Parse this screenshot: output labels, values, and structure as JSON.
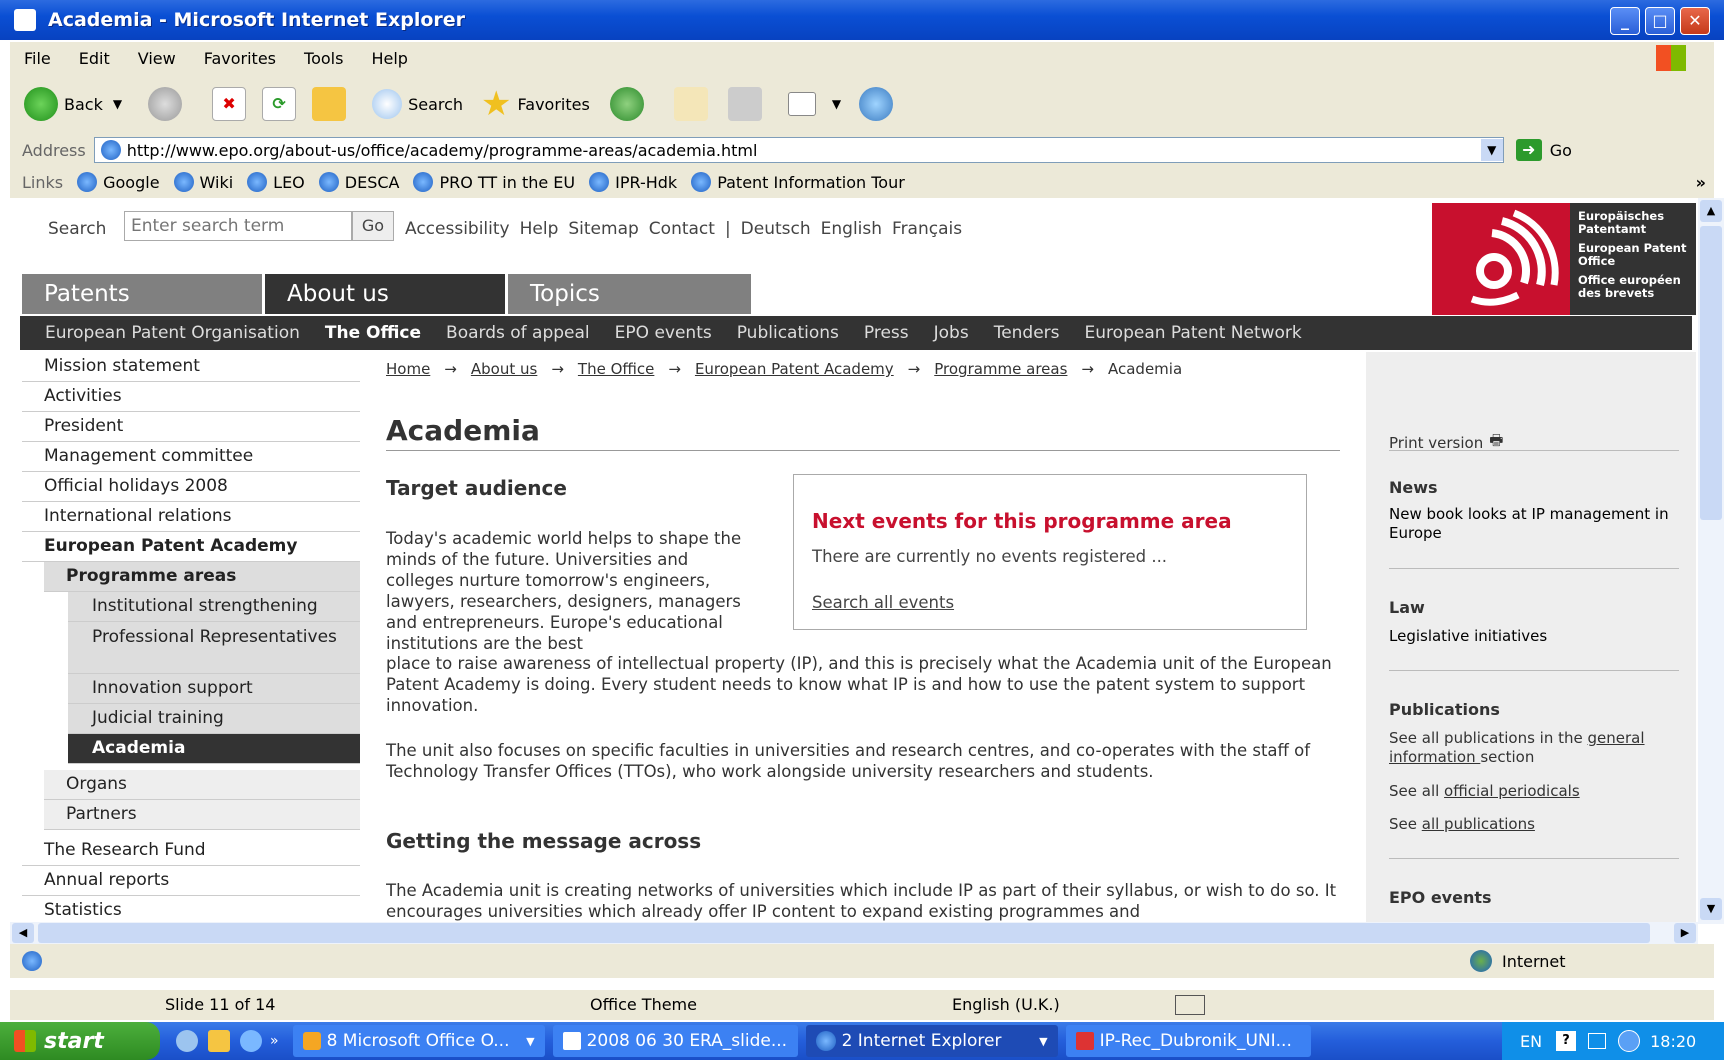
{
  "window": {
    "title": "Academia - Microsoft Internet Explorer"
  },
  "menu": [
    "File",
    "Edit",
    "View",
    "Favorites",
    "Tools",
    "Help"
  ],
  "toolbar": {
    "back": "Back",
    "search": "Search",
    "favorites": "Favorites"
  },
  "address": {
    "label": "Address",
    "url": "http://www.epo.org/about-us/office/academy/programme-areas/academia.html",
    "go": "Go"
  },
  "links": {
    "label": "Links",
    "items": [
      "Google",
      "Wiki",
      "LEO",
      "DESCA",
      "PRO TT in the EU",
      "IPR-Hdk",
      "Patent Information Tour"
    ]
  },
  "site": {
    "search_label": "Search",
    "search_placeholder": "Enter search term",
    "search_go": "Go",
    "utility": [
      "Accessibility",
      "Help",
      "Sitemap",
      "Contact",
      "|",
      "Deutsch",
      "English",
      "Français"
    ],
    "logo": [
      "Europäisches Patentamt",
      "European Patent Office",
      "Office européen des brevets"
    ],
    "tabs": [
      "Patents",
      "About us",
      "Topics"
    ],
    "subnav": [
      "European Patent Organisation",
      "The Office",
      "Boards of appeal",
      "EPO events",
      "Publications",
      "Press",
      "Jobs",
      "Tenders",
      "European Patent Network"
    ],
    "leftnav": [
      "Mission statement",
      "Activities",
      "President",
      "Management committee",
      "Official holidays 2008",
      "International relations",
      "European Patent Academy",
      "Programme areas",
      "Institutional strengthening",
      "Professional Representatives",
      "Innovation support",
      "Judicial training",
      "Academia",
      "Organs",
      "Partners",
      "The Research Fund",
      "Annual reports",
      "Statistics"
    ],
    "breadcrumb": [
      "Home",
      "About us",
      "The Office",
      "European Patent Academy",
      "Programme areas",
      "Academia"
    ],
    "breadcrumb_sep": "→",
    "heading": "Academia",
    "target_audience": "Target audience",
    "para1_wrap": "Today's academic world helps to shape the minds of the future. Universities and colleges nurture tomorrow's engineers, lawyers, researchers, designers, managers and entrepreneurs. Europe's educational institutions are the best",
    "para1_rest": "place to raise awareness of intellectual property (IP), and this is precisely what the Academia unit of the European Patent Academy is doing. Every student needs to know what IP is and how to use the patent system to support innovation.",
    "para2": "The unit also focuses on specific faculties in universities and research centres, and co-operates with the staff of Technology Transfer Offices (TTOs), who work alongside university researchers and students.",
    "getting_heading": "Getting the message across",
    "para3": "The Academia unit is creating networks of universities which include IP as part of their syllabus, or wish to do so. It encourages universities which already offer IP content to expand existing programmes and",
    "events_box": {
      "title": "Next events for this programme area",
      "text": "There are currently no events registered ...",
      "link": "Search all events"
    },
    "right": {
      "print": "Print version",
      "news_h": "News",
      "news_link": "New book looks at IP management in Europe",
      "law_h": "Law",
      "law_link": "Legislative initiatives",
      "pub_h": "Publications",
      "pub1_pre": "See all publications in the ",
      "pub1_link": "general information ",
      "pub1_post": "section",
      "pub2_pre": "See all ",
      "pub2_link": "official periodicals",
      "pub3_pre": "See ",
      "pub3_link": "all publications",
      "events_h": "EPO events"
    }
  },
  "status": {
    "zone": "Internet"
  },
  "ppt": {
    "slide": "Slide 11 of 14",
    "theme": "Office Theme",
    "lang": "English (U.K.)"
  },
  "taskbar": {
    "start": "start",
    "tasks": [
      "8 Microsoft Office O...",
      "2008 06 30 ERA_slide...",
      "2 Internet Explorer",
      "IP-Rec_Dubronik_UNI..."
    ],
    "lang": "EN",
    "time": "18:20"
  },
  "colors": {
    "accent_red": "#c8102e",
    "nav_dark": "#333333",
    "tab_gray": "#808080",
    "xp_blue": "#0a4fd4"
  }
}
